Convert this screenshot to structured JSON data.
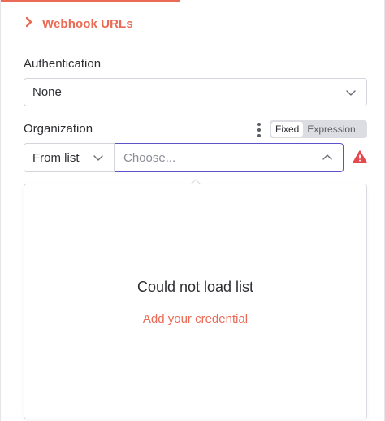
{
  "section": {
    "title": "Webhook URLs",
    "icon": "chevron-right-icon",
    "accent_color": "#ea6a55"
  },
  "authentication": {
    "label": "Authentication",
    "selected": "None"
  },
  "organization": {
    "label": "Organization",
    "toggle": {
      "options": [
        "Fixed",
        "Expression"
      ],
      "selected": "Fixed"
    },
    "mode": {
      "selected": "From list"
    },
    "search": {
      "placeholder": "Choose...",
      "value": ""
    },
    "warning_icon": "warning-triangle-icon"
  },
  "dropdown": {
    "message": "Could not load list",
    "action": "Add your credential"
  },
  "colors": {
    "accent": "#ea6a55",
    "focus_border": "#5c52c9",
    "warning": "#e5484d"
  }
}
